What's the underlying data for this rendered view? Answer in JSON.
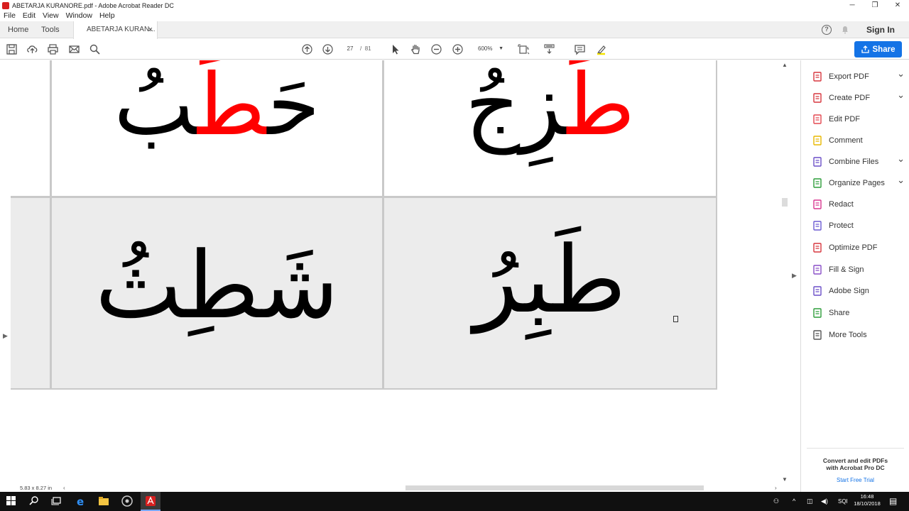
{
  "window": {
    "title": "ABETARJA KURANORE.pdf - Adobe Acrobat Reader DC"
  },
  "menu": [
    "File",
    "Edit",
    "View",
    "Window",
    "Help"
  ],
  "tabs": {
    "home": "Home",
    "tools": "Tools",
    "doc": "ABETARJA KURAN...",
    "sign_in": "Sign In"
  },
  "toolbar": {
    "current_page": "27",
    "page_sep": "/",
    "total_pages": "81",
    "zoom": "600%",
    "share_label": "Share"
  },
  "document": {
    "cells": [
      {
        "prefix": "",
        "red": "",
        "suffix": ""
      },
      {
        "prefix": "حَ",
        "red": "طَ",
        "suffix": "بُ"
      },
      {
        "prefix": "",
        "red": "طَ",
        "suffix": "زِجُ"
      },
      {
        "prefix": "",
        "red": "",
        "suffix": ""
      },
      {
        "prefix": "شَطِثُ",
        "red": "",
        "suffix": ""
      },
      {
        "prefix": "طَبِرُ",
        "red": "",
        "suffix": ""
      }
    ],
    "page_size": "5.83 x 8.27 in"
  },
  "right_pane": {
    "items": [
      {
        "label": "Export PDF",
        "icon": "export-pdf-icon",
        "color": "#d7373f",
        "expand": true
      },
      {
        "label": "Create PDF",
        "icon": "create-pdf-icon",
        "color": "#d7373f",
        "expand": true
      },
      {
        "label": "Edit PDF",
        "icon": "edit-pdf-icon",
        "color": "#e34850",
        "expand": false
      },
      {
        "label": "Comment",
        "icon": "comment-icon",
        "color": "#e8b800",
        "expand": false
      },
      {
        "label": "Combine Files",
        "icon": "combine-files-icon",
        "color": "#6b4fc8",
        "expand": true
      },
      {
        "label": "Organize Pages",
        "icon": "organize-pages-icon",
        "color": "#2d9d3a",
        "expand": true
      },
      {
        "label": "Redact",
        "icon": "redact-icon",
        "color": "#d83790",
        "expand": false
      },
      {
        "label": "Protect",
        "icon": "protect-icon",
        "color": "#6b5bd2",
        "expand": false
      },
      {
        "label": "Optimize PDF",
        "icon": "optimize-pdf-icon",
        "color": "#d7373f",
        "expand": false
      },
      {
        "label": "Fill & Sign",
        "icon": "fill-sign-icon",
        "color": "#8a4fc8",
        "expand": false
      },
      {
        "label": "Adobe Sign",
        "icon": "adobe-sign-icon",
        "color": "#6b4fc8",
        "expand": false
      },
      {
        "label": "Share",
        "icon": "share-icon",
        "color": "#2d9d3a",
        "expand": false
      },
      {
        "label": "More Tools",
        "icon": "more-tools-icon",
        "color": "#555555",
        "expand": false
      }
    ],
    "promo_line1": "Convert and edit PDFs",
    "promo_line2": "with Acrobat Pro DC",
    "promo_link": "Start Free Trial"
  },
  "taskbar": {
    "language": "SQI",
    "time": "16:48",
    "date": "18/10/2018"
  },
  "colors": {
    "accent": "#1473e6",
    "highlight_red": "#ff0000"
  }
}
